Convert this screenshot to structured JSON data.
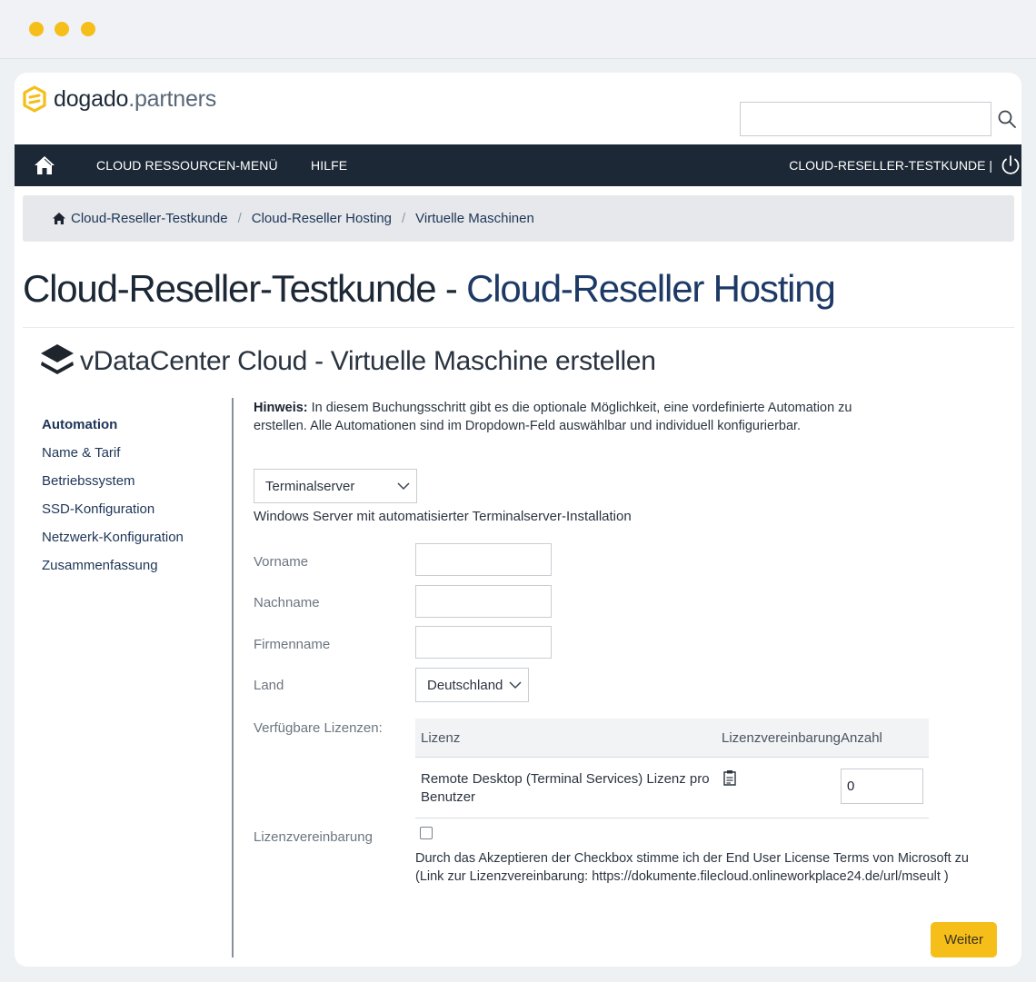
{
  "brand": {
    "name_main": "dogado",
    "name_suffix": ".partners",
    "accent": "#f5be19",
    "nav_bg": "#1c2836"
  },
  "search": {
    "placeholder": ""
  },
  "nav": {
    "items": [
      "CLOUD RESSOURCEN-MENÜ",
      "HILFE"
    ],
    "user": "CLOUD-RESELLER-TESTKUNDE |"
  },
  "breadcrumb": [
    "Cloud-Reseller-Testkunde",
    "Cloud-Reseller Hosting",
    "Virtuelle Maschinen"
  ],
  "breadcrumb_sep": "/",
  "page_title": {
    "main": "Cloud-Reseller-Testkunde - ",
    "accent": "Cloud-Reseller Hosting"
  },
  "section_title": "vDataCenter Cloud - Virtuelle Maschine erstellen",
  "steps": [
    "Automation",
    "Name & Tarif",
    "Betriebssystem",
    "SSD-Konfiguration",
    "Netzwerk-Konfiguration",
    "Zusammenfassung"
  ],
  "hint": {
    "label": "Hinweis:",
    "text": " In diesem Buchungsschritt gibt es die optionale Möglichkeit, eine vordefinierte Automation zu erstellen. Alle Automationen sind im Dropdown-Feld auswählbar und individuell konfigurierbar."
  },
  "automation": {
    "selected": "Terminalserver",
    "description": "Windows Server mit automatisierter Terminalserver-Installation"
  },
  "form": {
    "vorname": {
      "label": "Vorname",
      "value": ""
    },
    "nachname": {
      "label": "Nachname",
      "value": ""
    },
    "firmenname": {
      "label": "Firmenname",
      "value": ""
    },
    "land": {
      "label": "Land",
      "selected": "Deutschland"
    },
    "licenses_label": "Verfügbare Lizenzen:",
    "agreement_label": "Lizenzvereinbarung"
  },
  "license_table": {
    "headers": [
      "Lizenz",
      "Lizenzvereinbarung",
      "Anzahl"
    ],
    "rows": [
      {
        "name": "Remote Desktop (Terminal Services) Lizenz pro Benutzer",
        "qty": "0"
      }
    ]
  },
  "agreement_text": "Durch das Akzeptieren der Checkbox stimme ich der End User License Terms von Microsoft zu (Link zur Lizenzvereinbarung: https://dokumente.filecloud.onlineworkplace24.de/url/mseult )",
  "next_button": "Weiter"
}
